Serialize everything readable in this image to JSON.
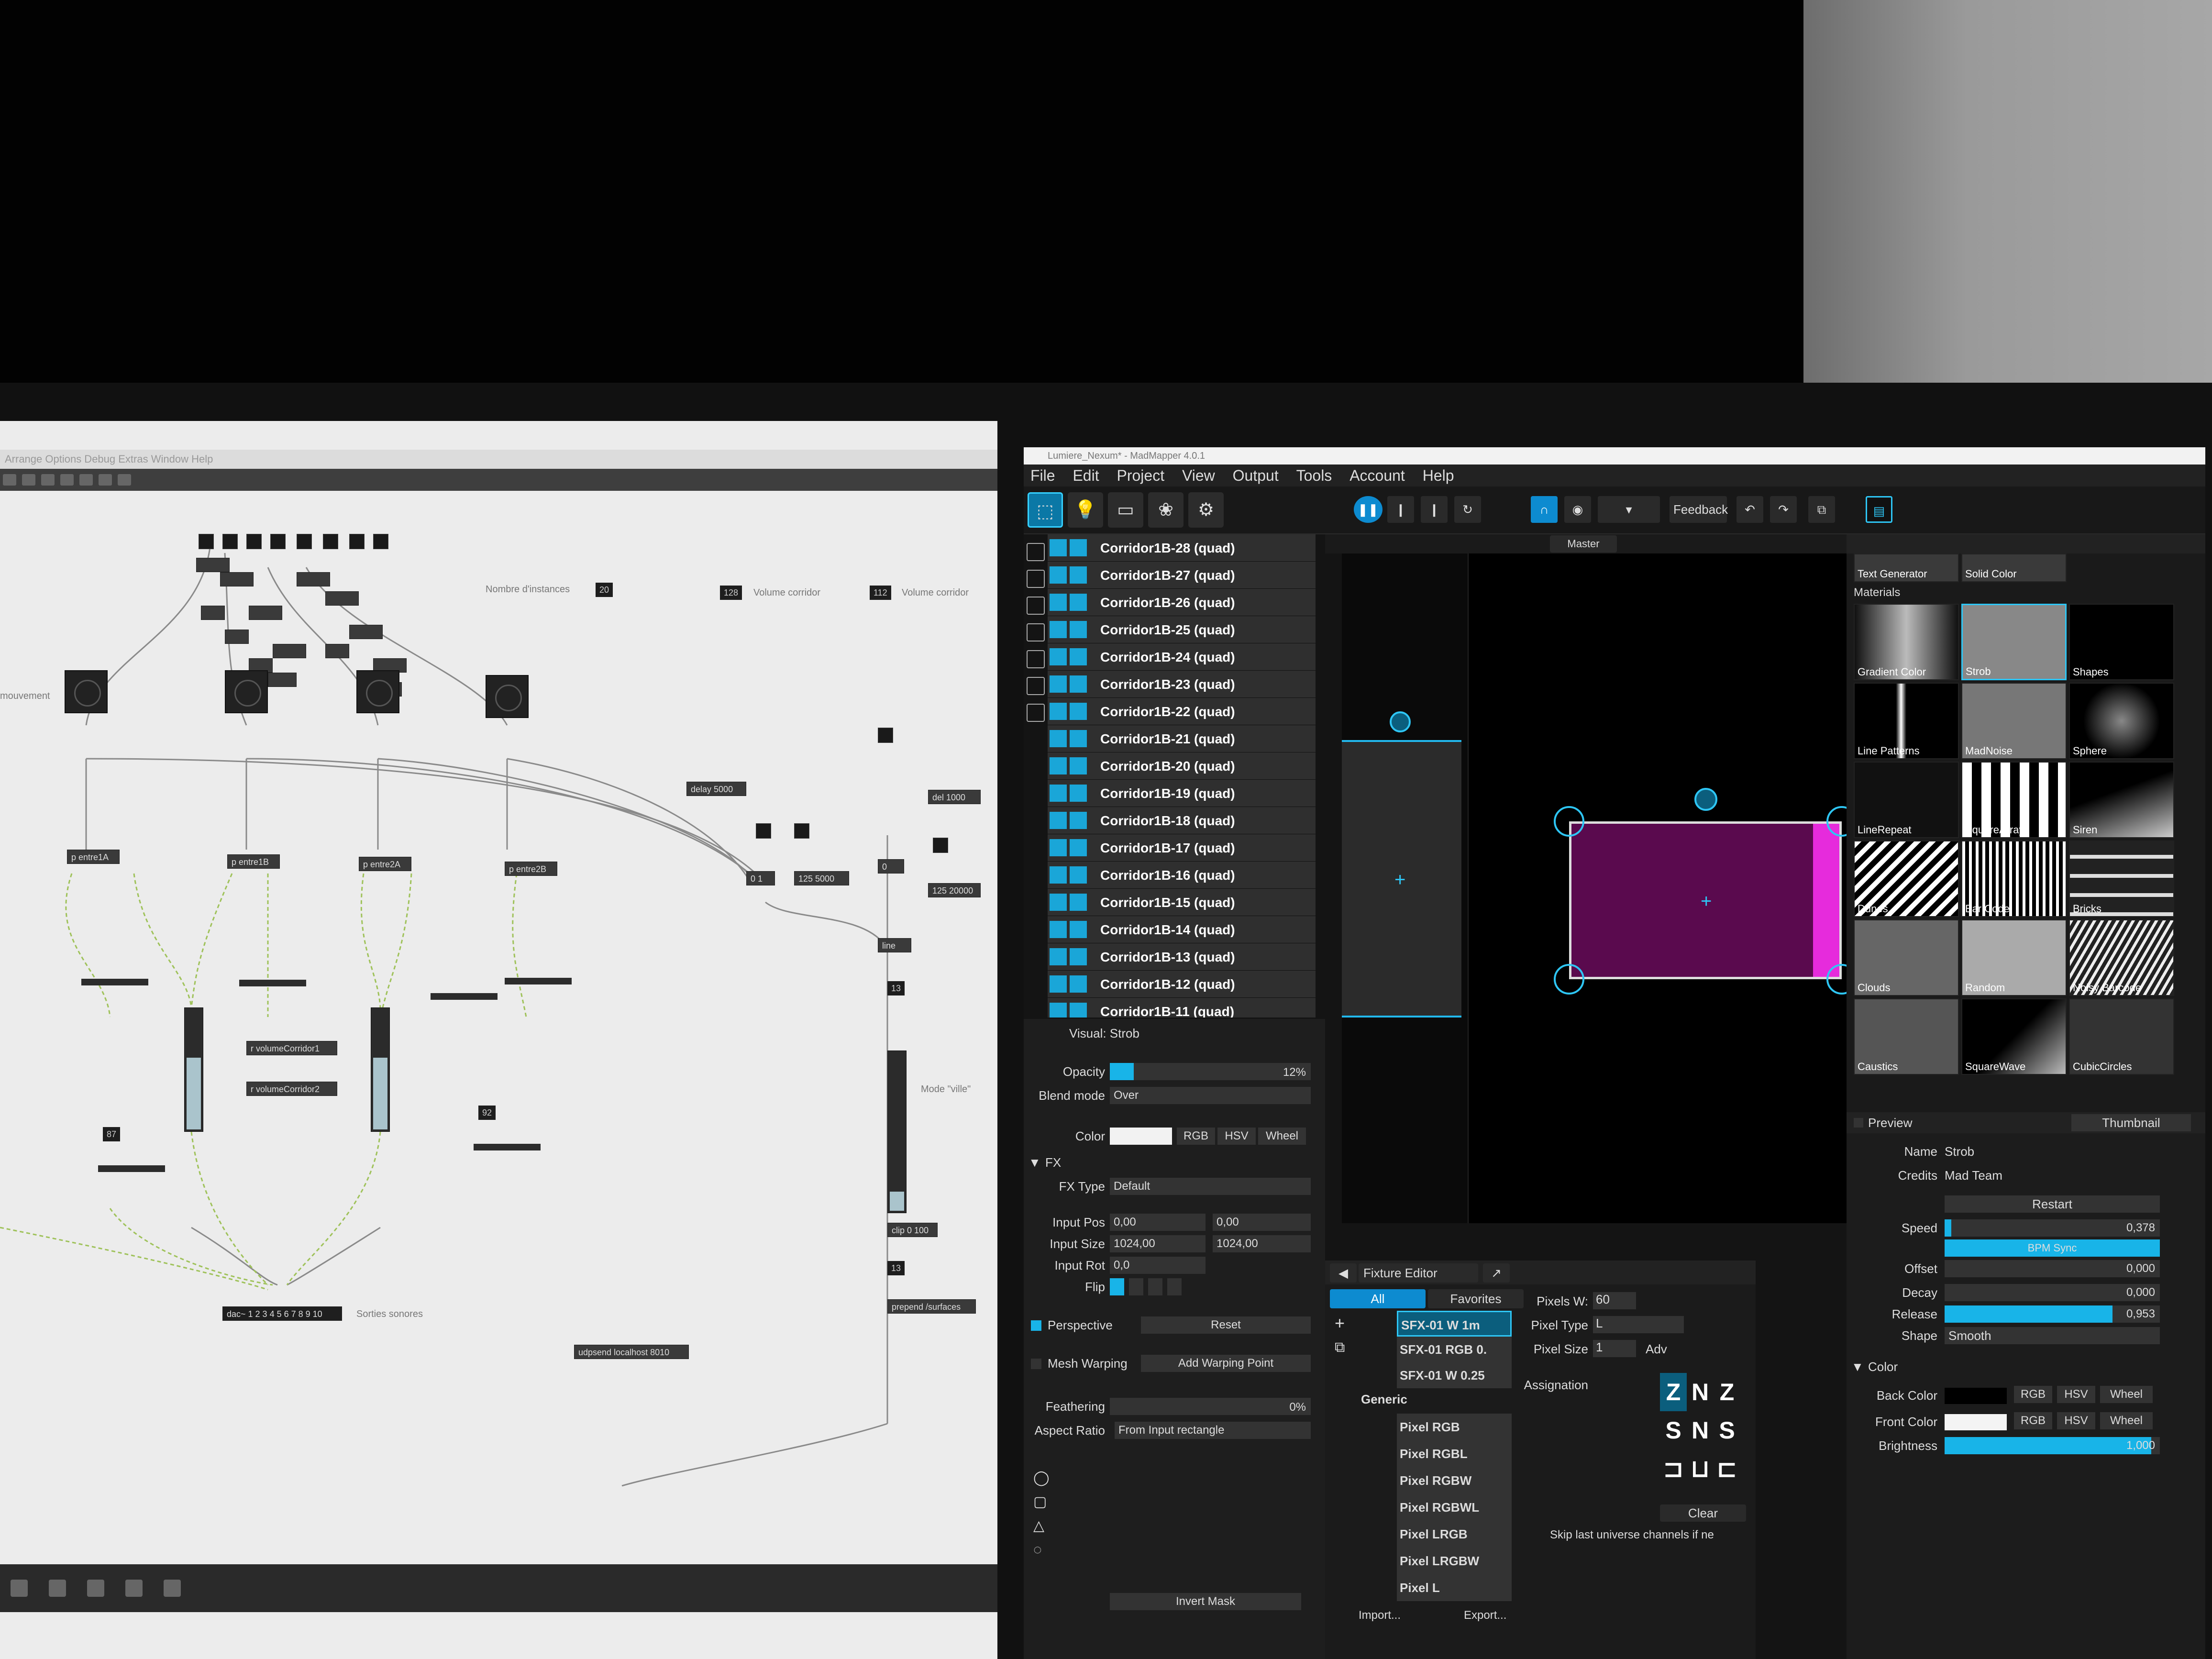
{
  "max": {
    "menu": "   Arrange  Options  Debug  Extras  Window  Help",
    "comments": {
      "instances": "Nombre d'instances",
      "volume1": "Volume corridor",
      "volume2": "Volume corridor",
      "mouvement": "mouvement",
      "mode": "Mode \"ville\"",
      "sorties": "Sorties sonores"
    },
    "numbers": {
      "instances": "20",
      "vol1": "128",
      "vol2": "112",
      "n87": "87",
      "n92": "92",
      "n13": "13",
      "n13b": "13",
      "n0": "0",
      "n01": "0 1"
    },
    "objects": {
      "delay": "delay 5000",
      "del1000": "del 1000",
      "entre1a": "p entre1A",
      "entre1b": "p entre1B",
      "entre2a": "p entre2A",
      "entre2b": "p entre2B",
      "msg125a": "125 5000",
      "msg125b": "125 20000",
      "line": "line",
      "volc1": "r volumeCorridor1",
      "volc2": "r volumeCorridor2",
      "clip": "clip 0 100",
      "prepend": "prepend /surfaces",
      "udp": "udpsend localhost 8010",
      "dac": "dac~ 1 2 3 4 5 6 7 8 9 10"
    }
  },
  "madmapper": {
    "title": "Lumiere_Nexum* - MadMapper 4.0.1",
    "menu": [
      "File",
      "Edit",
      "Project",
      "View",
      "Output",
      "Tools",
      "Account",
      "Help"
    ],
    "toolbar": {
      "feedback": "Feedback",
      "master": "Master"
    },
    "surfaces": [
      "Corridor1B-28 (quad)",
      "Corridor1B-27 (quad)",
      "Corridor1B-26 (quad)",
      "Corridor1B-25 (quad)",
      "Corridor1B-24 (quad)",
      "Corridor1B-23 (quad)",
      "Corridor1B-22 (quad)",
      "Corridor1B-21 (quad)",
      "Corridor1B-20 (quad)",
      "Corridor1B-19 (quad)",
      "Corridor1B-18 (quad)",
      "Corridor1B-17 (quad)",
      "Corridor1B-16 (quad)",
      "Corridor1B-15 (quad)",
      "Corridor1B-14 (quad)",
      "Corridor1B-13 (quad)",
      "Corridor1B-12 (quad)",
      "Corridor1B-11 (quad)"
    ],
    "surface_props": {
      "header": "Visual: Strob",
      "opacity_label": "Opacity",
      "opacity_value": "12%",
      "opacity_fraction": 0.12,
      "blend_label": "Blend mode",
      "blend_value": "Over",
      "color_label": "Color",
      "rgb": "RGB",
      "hsv": "HSV",
      "wheel": "Wheel",
      "fx_section": "FX",
      "fx_type_label": "FX Type",
      "fx_type_value": "Default",
      "input_pos_label": "Input Pos",
      "input_pos_x": "0,00",
      "input_pos_y": "0,00",
      "input_size_label": "Input Size",
      "input_size_x": "1024,00",
      "input_size_y": "1024,00",
      "input_rot_label": "Input Rot",
      "input_rot_value": "0,0",
      "flip_label": "Flip",
      "perspective_label": "Perspective",
      "reset_label": "Reset",
      "mesh_label": "Mesh Warping",
      "add_warp_label": "Add Warping Point",
      "feathering_label": "Feathering",
      "feathering_value": "0%",
      "aspect_label": "Aspect Ratio",
      "aspect_value": "From Input rectangle",
      "invert_mask": "Invert Mask"
    },
    "fixture": {
      "editor_label": "Fixture Editor",
      "tab_all": "All",
      "tab_favorites": "Favorites",
      "items": [
        "SFX-01 W 1m",
        "SFX-01 RGB 0.",
        "SFX-01 W 0.25"
      ],
      "generic_label": "Generic",
      "generic_items": [
        "Pixel RGB",
        "Pixel RGBL",
        "Pixel RGBW",
        "Pixel RGBWL",
        "Pixel LRGB",
        "Pixel LRGBW",
        "Pixel L"
      ],
      "pixels_w_label": "Pixels W:",
      "pixels_w_value": "60",
      "pixel_type_label": "Pixel Type",
      "pixel_type_value": "L",
      "pixel_size_label": "Pixel Size",
      "pixel_size_value": "1",
      "adv_label": "Adv",
      "assignation_label": "Assignation",
      "clear_label": "Clear",
      "skip_label": "Skip last universe channels if ne",
      "import_label": "Import...",
      "export_label": "Export..."
    },
    "materials": {
      "top_labels": [
        "Text Generator",
        "Solid Color"
      ],
      "section": "Materials",
      "tiles": [
        "Gradient Color",
        "Strob",
        "Shapes",
        "Line Patterns",
        "MadNoise",
        "Sphere",
        "LineRepeat",
        "SquareArray",
        "Siren",
        "Dunes",
        "Bar Code",
        "Bricks",
        "Clouds",
        "Random",
        "Noisy Barcode",
        "Caustics",
        "SquareWave",
        "CubicCircles"
      ]
    },
    "material_props": {
      "preview_label": "Preview",
      "thumbnail_label": "Thumbnail",
      "name_label": "Name",
      "name_value": "Strob",
      "credits_label": "Credits",
      "credits_value": "Mad Team",
      "restart_label": "Restart",
      "speed_label": "Speed",
      "speed_value": "0,378",
      "speed_fraction": 0.03,
      "bpm_sync": "BPM Sync",
      "offset_label": "Offset",
      "offset_value": "0,000",
      "decay_label": "Decay",
      "decay_value": "0,000",
      "release_label": "Release",
      "release_value": "0,953",
      "release_fraction": 0.78,
      "shape_label": "Shape",
      "shape_value": "Smooth",
      "color_section": "Color",
      "back_color_label": "Back Color",
      "front_color_label": "Front Color",
      "brightness_label": "Brightness",
      "brightness_value": "1,000",
      "brightness_fraction": 0.96
    }
  }
}
